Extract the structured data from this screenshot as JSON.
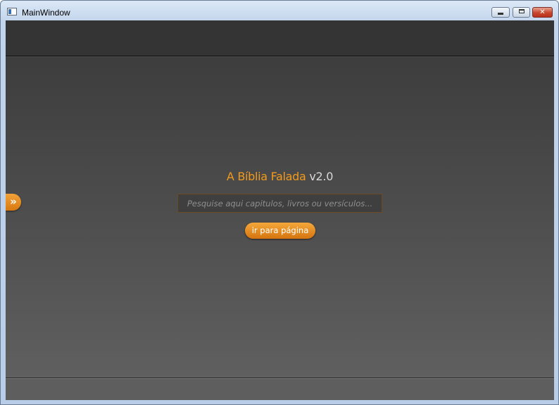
{
  "window": {
    "title": "MainWindow",
    "controls": {
      "minimize": "minimize",
      "maximize": "maximize",
      "close": "✕"
    }
  },
  "sidebar_toggle": {
    "label": "»"
  },
  "app": {
    "name": "A Bíblia Falada",
    "version": "v2.0"
  },
  "search": {
    "placeholder": "Pesquise aqui capitulos, livros ou versículos...",
    "value": ""
  },
  "go_button": {
    "label": "ir para página"
  },
  "colors": {
    "accent_orange": "#f29a1c",
    "background_top": "#3a3a3a",
    "background_bottom": "#626262"
  }
}
